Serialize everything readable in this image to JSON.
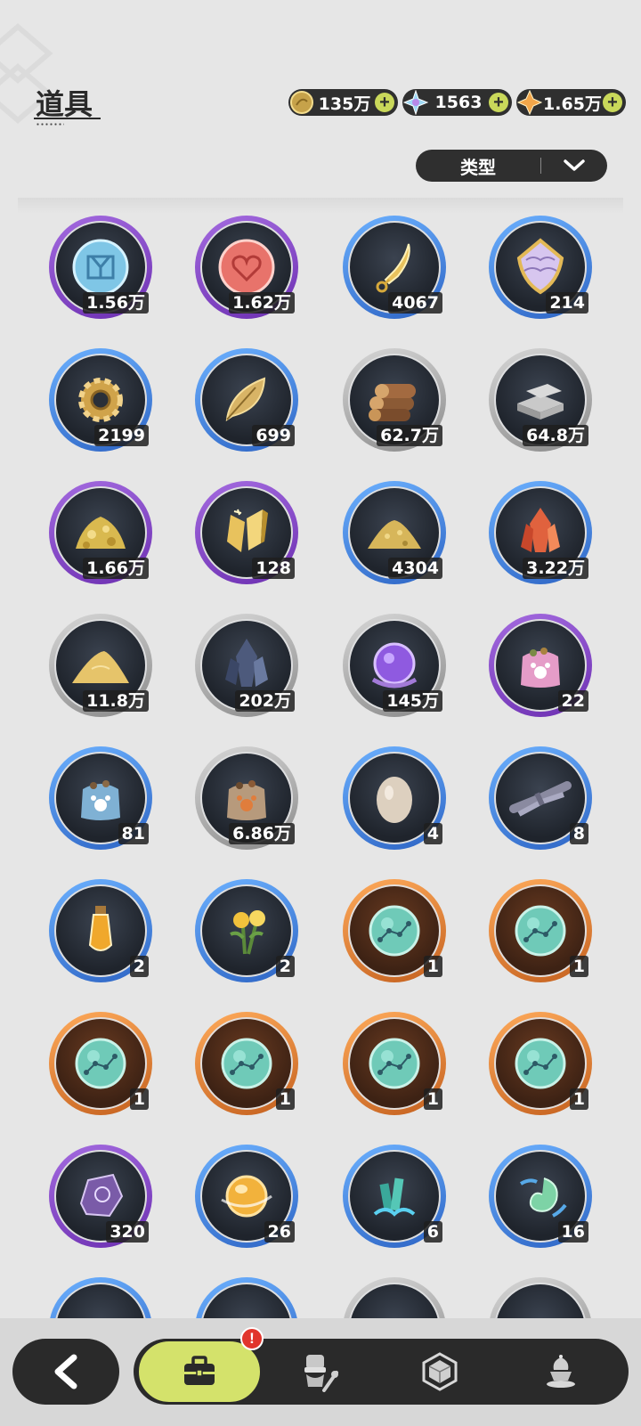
{
  "header": {
    "title": "道具"
  },
  "currencies": [
    {
      "name": "gold-coin",
      "value": "135万",
      "color": "#d8b75a"
    },
    {
      "name": "crystal-gem",
      "value": "1563",
      "color": "#8fd2f0"
    },
    {
      "name": "star-shard",
      "value": "1.65万",
      "color": "#f0a44a"
    }
  ],
  "filter": {
    "label": "类型"
  },
  "items": [
    {
      "icon": "blue-rune-coin-icon",
      "rarity": "purple",
      "count": "1.56万"
    },
    {
      "icon": "red-heart-coin-icon",
      "rarity": "purple",
      "count": "1.62万"
    },
    {
      "icon": "golden-blade-icon",
      "rarity": "blue",
      "count": "4067"
    },
    {
      "icon": "scale-shield-icon",
      "rarity": "blue",
      "count": "214"
    },
    {
      "icon": "gear-icon",
      "rarity": "blue",
      "count": "2199"
    },
    {
      "icon": "golden-leaf-icon",
      "rarity": "blue",
      "count": "699"
    },
    {
      "icon": "wood-logs-icon",
      "rarity": "gray",
      "count": "62.7万"
    },
    {
      "icon": "stone-bricks-icon",
      "rarity": "gray",
      "count": "64.8万"
    },
    {
      "icon": "gold-ore-pile-icon",
      "rarity": "purple",
      "count": "1.66万"
    },
    {
      "icon": "gold-crystal-icon",
      "rarity": "purple",
      "count": "128"
    },
    {
      "icon": "gold-sand-pile-icon",
      "rarity": "blue",
      "count": "4304"
    },
    {
      "icon": "red-crystal-icon",
      "rarity": "blue",
      "count": "3.22万"
    },
    {
      "icon": "sand-pile-icon",
      "rarity": "gray",
      "count": "11.8万"
    },
    {
      "icon": "dark-crystal-icon",
      "rarity": "gray",
      "count": "202万"
    },
    {
      "icon": "purple-orb-icon",
      "rarity": "gray",
      "count": "145万"
    },
    {
      "icon": "pink-feed-bag-icon",
      "rarity": "purple",
      "count": "22"
    },
    {
      "icon": "blue-feed-bag-icon",
      "rarity": "blue",
      "count": "81"
    },
    {
      "icon": "brown-feed-bag-icon",
      "rarity": "gray",
      "count": "6.86万"
    },
    {
      "icon": "egg-icon",
      "rarity": "blue",
      "count": "4"
    },
    {
      "icon": "herb-bundle-icon",
      "rarity": "blue",
      "count": "8"
    },
    {
      "icon": "potion-vial-icon",
      "rarity": "blue",
      "count": "2"
    },
    {
      "icon": "flower-bouquet-icon",
      "rarity": "blue",
      "count": "2"
    },
    {
      "icon": "constellation-orb-icon",
      "rarity": "orange",
      "count": "1"
    },
    {
      "icon": "constellation-orb-icon",
      "rarity": "orange",
      "count": "1"
    },
    {
      "icon": "constellation-orb-icon",
      "rarity": "orange",
      "count": "1"
    },
    {
      "icon": "constellation-orb-icon",
      "rarity": "orange",
      "count": "1"
    },
    {
      "icon": "constellation-orb-icon",
      "rarity": "orange",
      "count": "1"
    },
    {
      "icon": "constellation-orb-icon",
      "rarity": "orange",
      "count": "1"
    },
    {
      "icon": "purple-stone-icon",
      "rarity": "purple",
      "count": "320"
    },
    {
      "icon": "amber-orb-icon",
      "rarity": "blue",
      "count": "26"
    },
    {
      "icon": "green-crystal-icon",
      "rarity": "blue",
      "count": "6"
    },
    {
      "icon": "green-spirit-icon",
      "rarity": "blue",
      "count": "16"
    }
  ],
  "partial_row": [
    "blue",
    "blue",
    "gray",
    "gray"
  ],
  "bottom_nav": {
    "badge": "!",
    "tabs": [
      {
        "name": "bag-icon",
        "active": true
      },
      {
        "name": "chef-hat-icon",
        "active": false
      },
      {
        "name": "hexagon-gem-icon",
        "active": false
      },
      {
        "name": "dessert-icon",
        "active": false
      }
    ]
  }
}
